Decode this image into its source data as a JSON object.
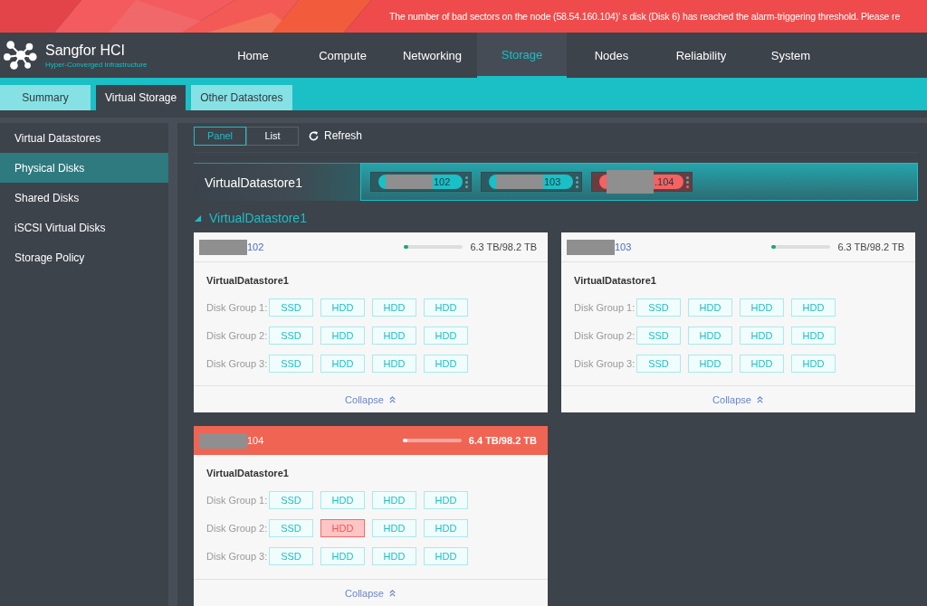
{
  "banner": {
    "message": "The number of bad sectors on the node (58.54.160.104)’ s disk (Disk 6) has reached the alarm-triggering threshold. Please re"
  },
  "brand": {
    "name": "Sangfor HCI",
    "tagline": "Hyper-Converged Infrastructure"
  },
  "nav": [
    {
      "label": "Home",
      "selected": false
    },
    {
      "label": "Compute",
      "selected": false
    },
    {
      "label": "Networking",
      "selected": false
    },
    {
      "label": "Storage",
      "selected": true
    },
    {
      "label": "Nodes",
      "selected": false
    },
    {
      "label": "Reliability",
      "selected": false
    },
    {
      "label": "System",
      "selected": false
    }
  ],
  "subtabs": [
    {
      "label": "Summary",
      "selected": false
    },
    {
      "label": "Virtual Storage",
      "selected": true
    },
    {
      "label": "Other Datastores",
      "selected": false
    }
  ],
  "sidebar": {
    "items": [
      {
        "label": "Virtual Datastores",
        "selected": false
      },
      {
        "label": "Physical Disks",
        "selected": true
      },
      {
        "label": "Shared Disks",
        "selected": false
      },
      {
        "label": "iSCSI Virtual Disks",
        "selected": false
      },
      {
        "label": "Storage Policy",
        "selected": false
      }
    ]
  },
  "toolbar": {
    "views": [
      {
        "label": "Panel",
        "selected": true
      },
      {
        "label": "List",
        "selected": false
      }
    ],
    "refresh": "Refresh"
  },
  "strip": {
    "datastore": "VirtualDatastore1",
    "nodes": [
      {
        "label": "102",
        "alarm": false
      },
      {
        "label": "103",
        "alarm": false
      },
      {
        "label": ".104",
        "alarm": true
      }
    ]
  },
  "section": {
    "title": "VirtualDatastore1",
    "expanded": true
  },
  "cards": [
    {
      "node": "102",
      "alarm": false,
      "level": 0.05,
      "usage": "6.3 TB/98.2 TB",
      "datastore": "VirtualDatastore1",
      "collapse": "Collapse",
      "groups": [
        {
          "label": "Disk Group 1:",
          "disks": [
            {
              "type": "SSD",
              "faulty": false
            },
            {
              "type": "HDD",
              "faulty": false
            },
            {
              "type": "HDD",
              "faulty": false
            },
            {
              "type": "HDD",
              "faulty": false
            }
          ]
        },
        {
          "label": "Disk Group 2:",
          "disks": [
            {
              "type": "SSD",
              "faulty": false
            },
            {
              "type": "HDD",
              "faulty": false
            },
            {
              "type": "HDD",
              "faulty": false
            },
            {
              "type": "HDD",
              "faulty": false
            }
          ]
        },
        {
          "label": "Disk Group 3:",
          "disks": [
            {
              "type": "SSD",
              "faulty": false
            },
            {
              "type": "HDD",
              "faulty": false
            },
            {
              "type": "HDD",
              "faulty": false
            },
            {
              "type": "HDD",
              "faulty": false
            }
          ]
        }
      ]
    },
    {
      "node": "103",
      "alarm": false,
      "level": 0.05,
      "usage": "6.3 TB/98.2 TB",
      "datastore": "VirtualDatastore1",
      "collapse": "Collapse",
      "groups": [
        {
          "label": "Disk Group 1:",
          "disks": [
            {
              "type": "SSD",
              "faulty": false
            },
            {
              "type": "HDD",
              "faulty": false
            },
            {
              "type": "HDD",
              "faulty": false
            },
            {
              "type": "HDD",
              "faulty": false
            }
          ]
        },
        {
          "label": "Disk Group 2:",
          "disks": [
            {
              "type": "SSD",
              "faulty": false
            },
            {
              "type": "HDD",
              "faulty": false
            },
            {
              "type": "HDD",
              "faulty": false
            },
            {
              "type": "HDD",
              "faulty": false
            }
          ]
        },
        {
          "label": "Disk Group 3:",
          "disks": [
            {
              "type": "SSD",
              "faulty": false
            },
            {
              "type": "HDD",
              "faulty": false
            },
            {
              "type": "HDD",
              "faulty": false
            },
            {
              "type": "HDD",
              "faulty": false
            }
          ]
        }
      ]
    },
    {
      "node": "104",
      "alarm": true,
      "level": 0.06,
      "usage": "6.4 TB/98.2 TB",
      "datastore": "VirtualDatastore1",
      "collapse": "Collapse",
      "groups": [
        {
          "label": "Disk Group 1:",
          "disks": [
            {
              "type": "SSD",
              "faulty": false
            },
            {
              "type": "HDD",
              "faulty": false
            },
            {
              "type": "HDD",
              "faulty": false
            },
            {
              "type": "HDD",
              "faulty": false
            }
          ]
        },
        {
          "label": "Disk Group 2:",
          "disks": [
            {
              "type": "SSD",
              "faulty": false
            },
            {
              "type": "HDD",
              "faulty": true
            },
            {
              "type": "HDD",
              "faulty": false
            },
            {
              "type": "HDD",
              "faulty": false
            }
          ]
        },
        {
          "label": "Disk Group 3:",
          "disks": [
            {
              "type": "SSD",
              "faulty": false
            },
            {
              "type": "HDD",
              "faulty": false
            },
            {
              "type": "HDD",
              "faulty": false
            },
            {
              "type": "HDD",
              "faulty": false
            }
          ]
        }
      ]
    }
  ]
}
